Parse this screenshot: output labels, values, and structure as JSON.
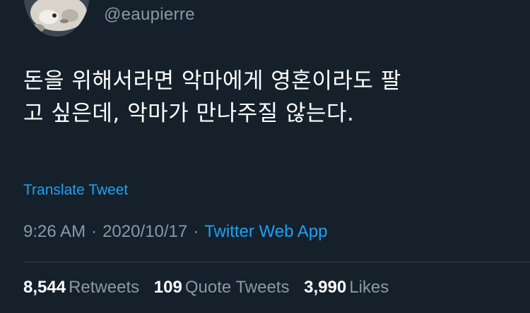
{
  "user": {
    "handle": "@eaupierre"
  },
  "tweet": {
    "text": "돈을 위해서라면 악마에게 영혼이라도 팔\n고 싶은데, 악마가 만나주질 않는다.",
    "translate_label": "Translate Tweet",
    "time": "9:26 AM",
    "date": "2020/10/17",
    "separator": "·",
    "source": "Twitter Web App"
  },
  "stats": {
    "retweets": {
      "count": "8,544",
      "label": "Retweets"
    },
    "quote_tweets": {
      "count": "109",
      "label": "Quote Tweets"
    },
    "likes": {
      "count": "3,990",
      "label": "Likes"
    }
  },
  "colors": {
    "background": "#15202b",
    "accent": "#1da1f2",
    "secondary_text": "#8899a6",
    "divider": "#38444d"
  }
}
